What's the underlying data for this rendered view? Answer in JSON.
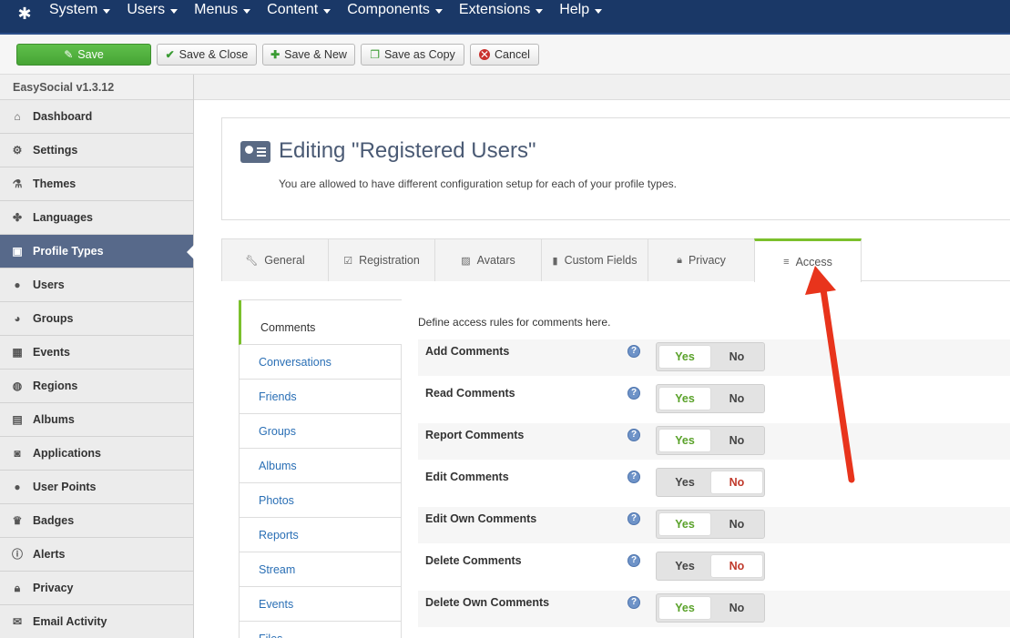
{
  "topbar": {
    "menu": [
      "System",
      "Users",
      "Menus",
      "Content",
      "Components",
      "Extensions",
      "Help"
    ]
  },
  "toolbar": {
    "save": "Save",
    "save_close": "Save & Close",
    "save_new": "Save & New",
    "save_copy": "Save as Copy",
    "cancel": "Cancel"
  },
  "sidebar": {
    "version": "EasySocial v1.3.12",
    "items": [
      {
        "label": "Dashboard",
        "icon": "home-icon"
      },
      {
        "label": "Settings",
        "icon": "gear-icon"
      },
      {
        "label": "Themes",
        "icon": "flask-icon"
      },
      {
        "label": "Languages",
        "icon": "puzzle-icon"
      },
      {
        "label": "Profile Types",
        "icon": "id-card-icon"
      },
      {
        "label": "Users",
        "icon": "user-icon"
      },
      {
        "label": "Groups",
        "icon": "users-icon"
      },
      {
        "label": "Events",
        "icon": "calendar-icon"
      },
      {
        "label": "Regions",
        "icon": "globe-icon"
      },
      {
        "label": "Albums",
        "icon": "album-icon"
      },
      {
        "label": "Applications",
        "icon": "camera-icon"
      },
      {
        "label": "User Points",
        "icon": "circle-icon"
      },
      {
        "label": "Badges",
        "icon": "crown-icon"
      },
      {
        "label": "Alerts",
        "icon": "alert-icon"
      },
      {
        "label": "Privacy",
        "icon": "lock-icon"
      },
      {
        "label": "Email Activity",
        "icon": "envelope-icon"
      }
    ]
  },
  "header": {
    "title": "Editing \"Registered Users\"",
    "description": "You are allowed to have different configuration setup for each of your profile types."
  },
  "tabs": [
    "General",
    "Registration",
    "Avatars",
    "Custom Fields",
    "Privacy",
    "Access"
  ],
  "subnav": [
    "Comments",
    "Conversations",
    "Friends",
    "Groups",
    "Albums",
    "Photos",
    "Reports",
    "Stream",
    "Events",
    "Files"
  ],
  "access": {
    "description": "Define access rules for comments here.",
    "yes_label": "Yes",
    "no_label": "No",
    "rules": [
      {
        "label": "Add Comments",
        "value": "Yes"
      },
      {
        "label": "Read Comments",
        "value": "Yes"
      },
      {
        "label": "Report Comments",
        "value": "Yes"
      },
      {
        "label": "Edit Comments",
        "value": "No"
      },
      {
        "label": "Edit Own Comments",
        "value": "Yes"
      },
      {
        "label": "Delete Comments",
        "value": "No"
      },
      {
        "label": "Delete Own Comments",
        "value": "Yes"
      }
    ]
  },
  "colors": {
    "navbar": "#1a3867",
    "save_green": "#46a435",
    "active_sidebar": "#57698a",
    "tab_accent": "#7bc02c",
    "arrow": "#e8341c"
  }
}
